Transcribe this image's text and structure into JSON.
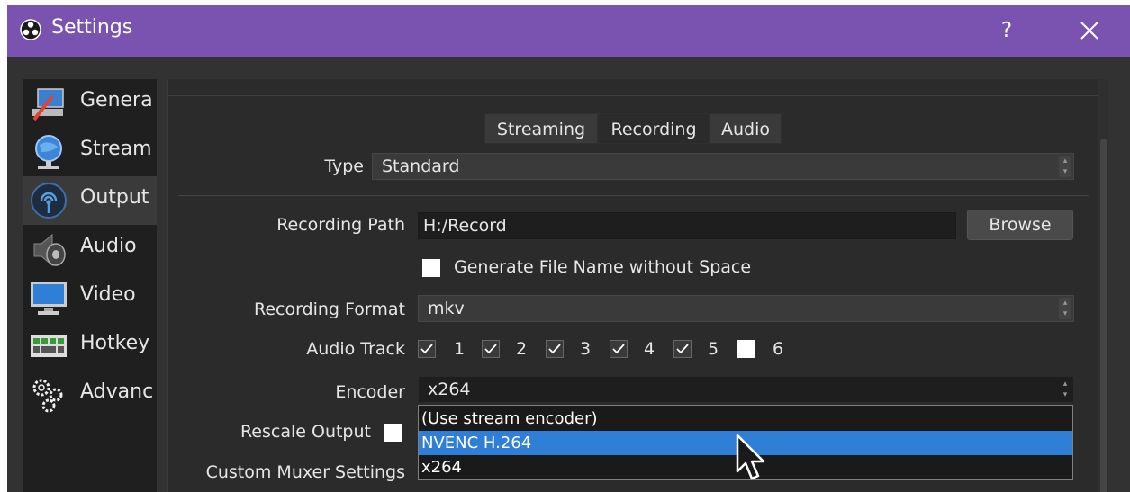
{
  "window": {
    "title": "Settings",
    "help_label": "?"
  },
  "sidebar": {
    "items": [
      {
        "label": "Genera",
        "icon": "general-icon",
        "selected": false
      },
      {
        "label": "Stream",
        "icon": "stream-icon",
        "selected": false
      },
      {
        "label": "Output",
        "icon": "output-icon",
        "selected": true
      },
      {
        "label": "Audio",
        "icon": "audio-icon",
        "selected": false
      },
      {
        "label": "Video",
        "icon": "video-icon",
        "selected": false
      },
      {
        "label": "Hotkey",
        "icon": "hotkey-icon",
        "selected": false
      },
      {
        "label": "Advanc",
        "icon": "advanced-icon",
        "selected": false
      }
    ]
  },
  "tabs": [
    {
      "label": "Streaming",
      "active": false
    },
    {
      "label": "Recording",
      "active": true
    },
    {
      "label": "Audio",
      "active": false
    }
  ],
  "type": {
    "label": "Type",
    "value": "Standard"
  },
  "recording_path": {
    "label": "Recording Path",
    "value": "H:/Record",
    "browse_label": "Browse"
  },
  "no_space": {
    "label": "Generate File Name without Space",
    "checked": false
  },
  "recording_format": {
    "label": "Recording Format",
    "value": "mkv"
  },
  "audio_track": {
    "label": "Audio Track",
    "tracks": [
      {
        "label": "1",
        "checked": true
      },
      {
        "label": "2",
        "checked": true
      },
      {
        "label": "3",
        "checked": true
      },
      {
        "label": "4",
        "checked": true
      },
      {
        "label": "5",
        "checked": true
      },
      {
        "label": "6",
        "checked": false
      }
    ]
  },
  "encoder": {
    "label": "Encoder",
    "value": "x264",
    "options": [
      {
        "label": "(Use stream encoder)",
        "highlighted": false
      },
      {
        "label": "NVENC H.264",
        "highlighted": true
      },
      {
        "label": "x264",
        "highlighted": false
      }
    ]
  },
  "rescale_output": {
    "label": "Rescale Output",
    "checked": false
  },
  "custom_muxer": {
    "label": "Custom Muxer Settings"
  },
  "colors": {
    "titlebar": "#7a52b0",
    "highlight": "#2f7fd6",
    "background": "#2b2b2b"
  }
}
